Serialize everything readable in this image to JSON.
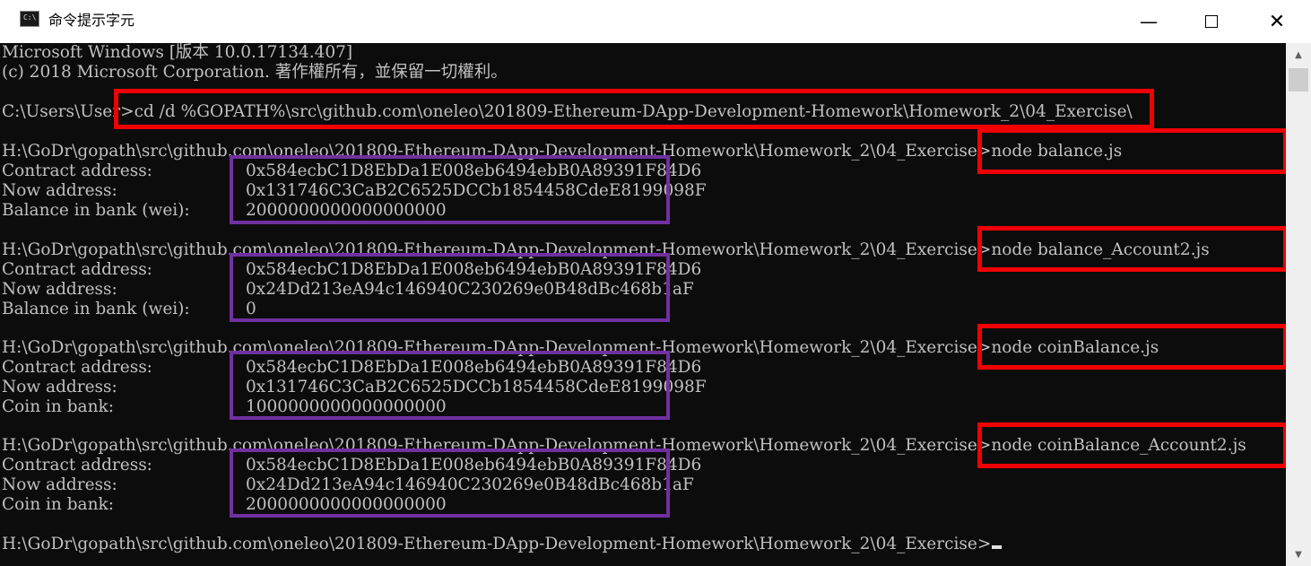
{
  "window": {
    "title": "命令提示字元",
    "app_icon_text": "C:\\",
    "minimize_glyph": "—",
    "close_glyph": "✕"
  },
  "console": {
    "header_line1": "Microsoft Windows [版本 10.0.17134.407]",
    "header_line2": "(c) 2018 Microsoft Corporation. 著作權所有，並保留一切權利。",
    "cd_line": "C:\\Users\\User>cd /d %GOPATH%\\src\\github.com\\oneleo\\201809-Ethereum-DApp-Development-Homework\\Homework_2\\04_Exercise\\",
    "prompt": "H:\\GoDr\\gopath\\src\\github.com\\oneleo\\201809-Ethereum-DApp-Development-Homework\\Homework_2\\04_Exercise>",
    "runs": [
      {
        "command": "node balance.js",
        "rows": [
          {
            "label": "Contract address:",
            "value": "0x584ecbC1D8EbDa1E008eb6494ebB0A89391F84D6"
          },
          {
            "label": "Now address:",
            "value": "0x131746C3CaB2C6525DCCb1854458CdeE8199098F"
          },
          {
            "label": "Balance in bank (wei):",
            "value": "2000000000000000000"
          }
        ]
      },
      {
        "command": "node balance_Account2.js",
        "rows": [
          {
            "label": "Contract address:",
            "value": "0x584ecbC1D8EbDa1E008eb6494ebB0A89391F84D6"
          },
          {
            "label": "Now address:",
            "value": "0x24Dd213eA94c146940C230269e0B48dBc468b1aF"
          },
          {
            "label": "Balance in bank (wei):",
            "value": "0"
          }
        ]
      },
      {
        "command": "node coinBalance.js",
        "rows": [
          {
            "label": "Contract address:",
            "value": "0x584ecbC1D8EbDa1E008eb6494ebB0A89391F84D6"
          },
          {
            "label": "Now address:",
            "value": "0x131746C3CaB2C6525DCCb1854458CdeE8199098F"
          },
          {
            "label": "Coin in bank:",
            "value": "1000000000000000000"
          }
        ]
      },
      {
        "command": "node coinBalance_Account2.js",
        "rows": [
          {
            "label": "Contract address:",
            "value": "0x584ecbC1D8EbDa1E008eb6494ebB0A89391F84D6"
          },
          {
            "label": "Now address:",
            "value": "0x24Dd213eA94c146940C230269e0B48dBc468b1aF"
          },
          {
            "label": "Coin in bank:",
            "value": "2000000000000000000"
          }
        ]
      }
    ]
  },
  "scrollbar": {
    "up_glyph": "▲",
    "down_glyph": "▼"
  },
  "colors": {
    "console_bg": "#0c0c0c",
    "console_text": "#c0c0c0",
    "highlight_red": "#f00000",
    "highlight_purple": "#7030a0"
  }
}
